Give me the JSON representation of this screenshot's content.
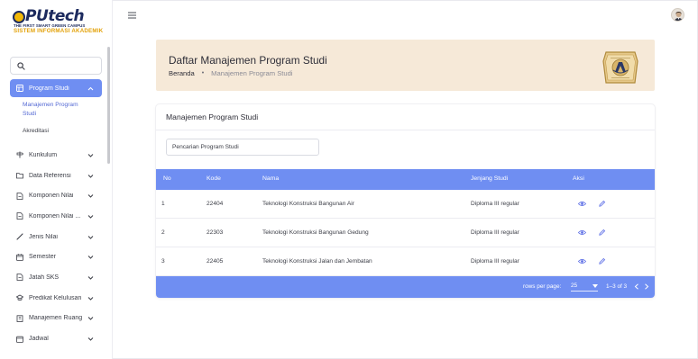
{
  "logo": {
    "text": "PUtech",
    "tagline": "THE FIRST SMART GREEN CAMPUS",
    "subtitle": "SISTEM INFORMASI AKADEMIK"
  },
  "sidebar": {
    "search_placeholder": "",
    "items": [
      {
        "label": "Program Studi",
        "icon": "grid-icon",
        "active": true,
        "expanded": true,
        "children": [
          {
            "label": "Manajemen Program Studi",
            "active": true
          },
          {
            "label": "Akreditasi",
            "active": false
          }
        ]
      },
      {
        "label": "Kurikulum",
        "icon": "signpost-icon"
      },
      {
        "label": "Data Referensi",
        "icon": "folder-icon"
      },
      {
        "label": "Komponen Nilai",
        "icon": "document-icon"
      },
      {
        "label": "Komponen Nilai ...",
        "icon": "document-icon"
      },
      {
        "label": "Jenis Nilai",
        "icon": "pencil-icon"
      },
      {
        "label": "Semester",
        "icon": "calendar-icon"
      },
      {
        "label": "Jatah SKS",
        "icon": "document-icon"
      },
      {
        "label": "Predikat Kelulusan",
        "icon": "cap-icon"
      },
      {
        "label": "Manajemen Ruang",
        "icon": "building-icon"
      },
      {
        "label": "Jadwal",
        "icon": "calendar-icon"
      }
    ]
  },
  "header": {
    "title": "Daftar Manajemen Program Studi",
    "breadcrumb_home": "Beranda",
    "breadcrumb_sep": "•",
    "breadcrumb_current": "Manajemen Program Studi"
  },
  "card": {
    "title": "Manajemen Program Studi",
    "filter_placeholder": "Pencarian Program Studi"
  },
  "table": {
    "columns": [
      "No",
      "Kode",
      "Nama",
      "Jenjang Studi",
      "Aksi"
    ],
    "rows": [
      {
        "no": "1",
        "kode": "22404",
        "nama": "Teknologi Konstruksi Bangunan Air",
        "jenjang": "Diploma III regular"
      },
      {
        "no": "2",
        "kode": "22303",
        "nama": "Teknologi Konstruksi Bangunan Gedung",
        "jenjang": "Diploma III regular"
      },
      {
        "no": "3",
        "kode": "22405",
        "nama": "Teknologi Konstruksi Jalan dan Jembatan",
        "jenjang": "Diploma III regular"
      }
    ],
    "footer": {
      "rows_per_page_label": "rows per page:",
      "rows_per_page": "25",
      "range": "1–3 of 3"
    }
  },
  "colors": {
    "accent": "#6f8ef2",
    "hero_bg": "#f6e9d8",
    "logo_navy": "#1c2a5e",
    "logo_gold": "#e3a20a"
  }
}
